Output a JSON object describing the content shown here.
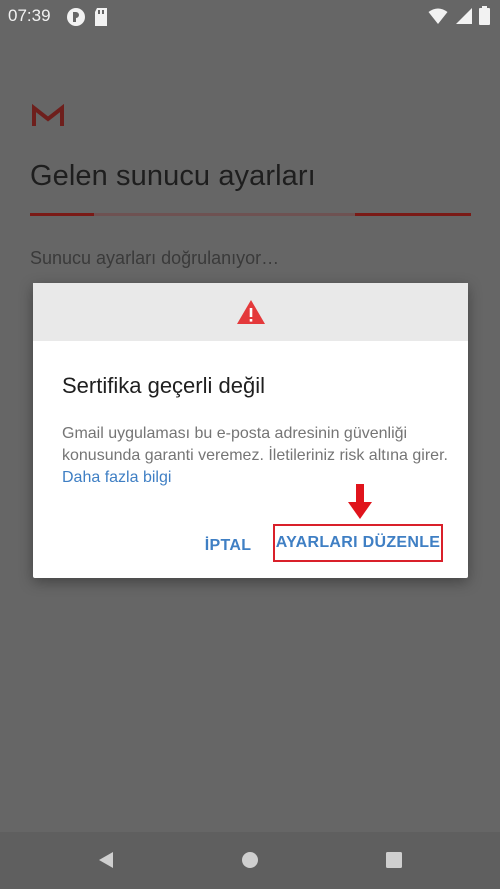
{
  "status_bar": {
    "time": "07:39",
    "left_icons": [
      "circular-app-icon",
      "sd-card-icon"
    ],
    "right_icons": [
      "wifi-icon",
      "signal-icon",
      "battery-icon"
    ]
  },
  "background": {
    "logo": "gmail-logo-icon",
    "title": "Gelen sunucu ayarları",
    "status_text": "Sunucu ayarları doğrulanıyor…"
  },
  "dialog": {
    "header_icon": "warning-triangle-icon",
    "title": "Sertifika geçerli değil",
    "body": "Gmail uygulaması bu e-posta adresinin güvenliği konusunda garanti veremez. İletileriniz risk altına girer.",
    "link": "Daha fazla bilgi",
    "cancel_label": "İPTAL",
    "edit_label": "AYARLARI DÜZENLE",
    "annotation_icon": "red-down-arrow-icon"
  },
  "nav_bar": {
    "icons": [
      "back-icon",
      "home-icon",
      "recents-icon"
    ]
  },
  "colors": {
    "scrim": "#666666",
    "accent": "#3f7fc4",
    "highlight": "#d9202a",
    "warning": "#e4393b"
  }
}
